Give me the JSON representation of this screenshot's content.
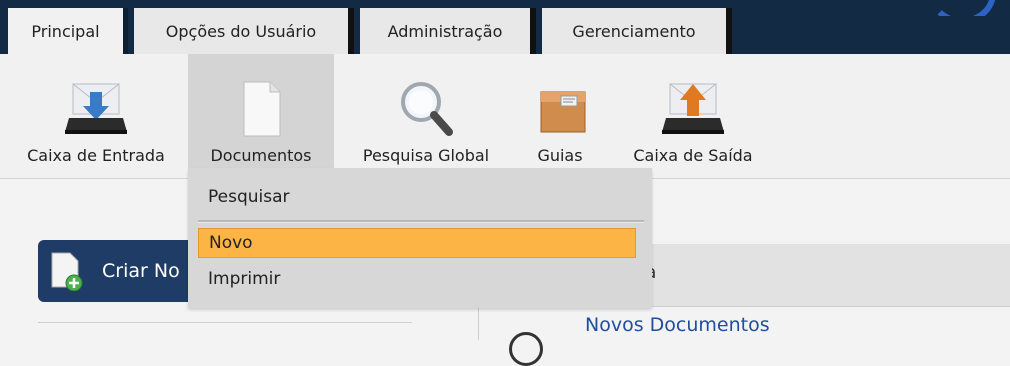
{
  "tabs": [
    {
      "label": "Principal"
    },
    {
      "label": "Opções do Usuário"
    },
    {
      "label": "Administração"
    },
    {
      "label": "Gerenciamento"
    }
  ],
  "toolbar": {
    "items": [
      {
        "label": "Caixa de Entrada",
        "icon": "inbox-download-icon"
      },
      {
        "label": "Documentos",
        "icon": "document-icon"
      },
      {
        "label": "Pesquisa Global",
        "icon": "magnifier-icon"
      },
      {
        "label": "Guias",
        "icon": "package-box-icon"
      },
      {
        "label": "Caixa de Saída",
        "icon": "outbox-upload-icon"
      }
    ]
  },
  "documents_menu": {
    "items": [
      {
        "label": "Pesquisar"
      },
      {
        "label": "Novo"
      },
      {
        "label": "Imprimir"
      }
    ],
    "selected_color": "#fcb445"
  },
  "left_panel": {
    "create_button_label": "Criar No"
  },
  "right_panel": {
    "header_text": "da",
    "link_text": "Novos Documentos"
  },
  "colors": {
    "topbar": "#132a45",
    "accent_button": "#1e3c66",
    "link": "#1f4e9c",
    "logo": "#2d63c4"
  }
}
